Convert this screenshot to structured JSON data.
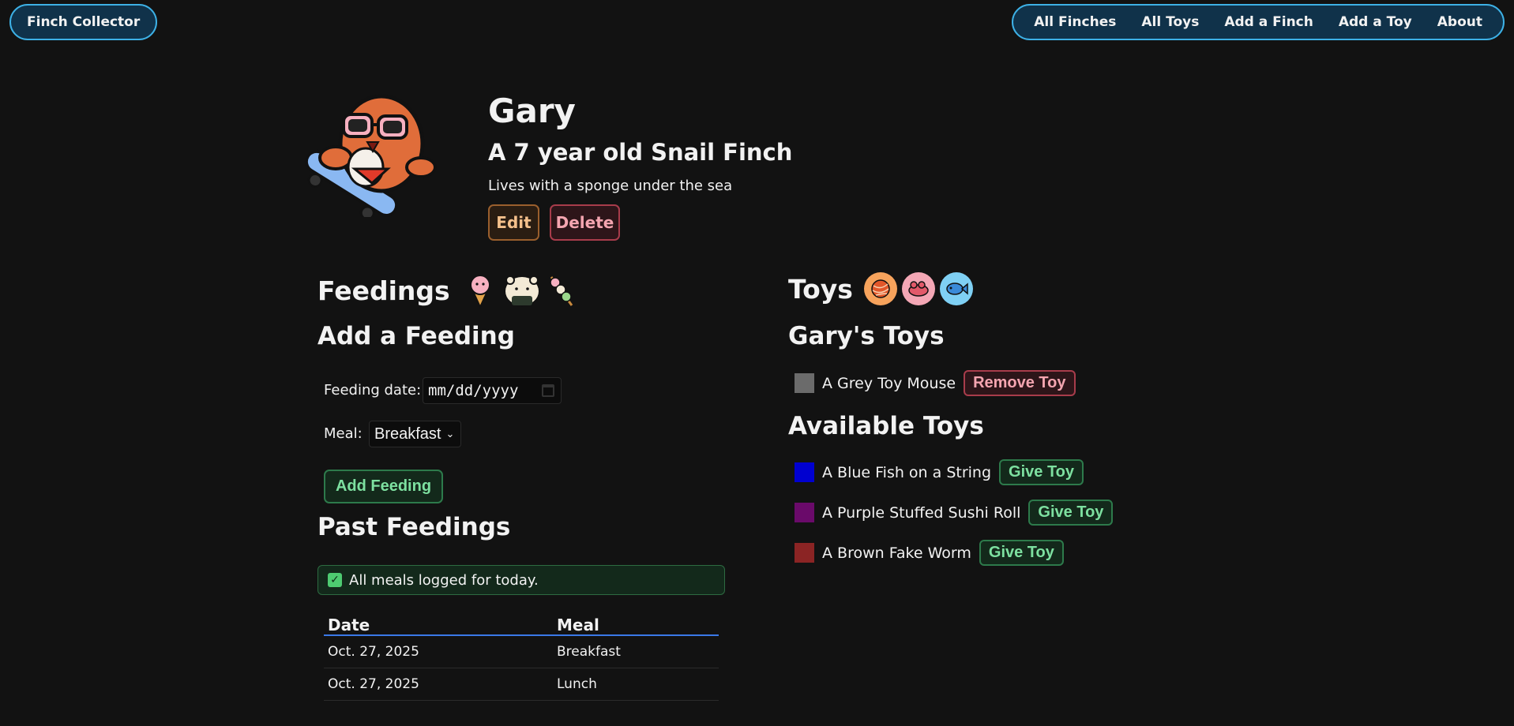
{
  "nav": {
    "brand": "Finch Collector",
    "links": [
      "All Finches",
      "All Toys",
      "Add a Finch",
      "Add a Toy",
      "About"
    ]
  },
  "finch": {
    "name": "Gary",
    "subtitle": "A 7 year old Snail Finch",
    "description": "Lives with a sponge under the sea",
    "avatar_icon": "finch-skateboard-icon",
    "edit_label": "Edit",
    "delete_label": "Delete"
  },
  "feedings": {
    "heading": "Feedings",
    "emojis": [
      "ice-cream-icon",
      "rice-ball-icon",
      "dango-icon"
    ],
    "add_heading": "Add a Feeding",
    "date_label": "Feeding date:",
    "date_placeholder": "mm/dd/yyyy",
    "meal_label": "Meal:",
    "meal_selected": "Breakfast",
    "add_button": "Add Feeding",
    "past_heading": "Past Feedings",
    "alert": "All meals logged for today.",
    "table": {
      "headers": [
        "Date",
        "Meal"
      ],
      "rows": [
        [
          "Oct. 27, 2025",
          "Breakfast"
        ],
        [
          "Oct. 27, 2025",
          "Lunch"
        ]
      ]
    }
  },
  "toys": {
    "heading": "Toys",
    "icons": [
      {
        "name": "yarn-ball-icon",
        "bg": "#f7a35c"
      },
      {
        "name": "toy-mouse-icon",
        "bg": "#f4a7b5"
      },
      {
        "name": "fish-toy-icon",
        "bg": "#7fd0f4"
      }
    ],
    "owned_heading": "Gary's Toys",
    "owned": [
      {
        "name": "A Grey Toy Mouse",
        "color": "#6b6b6b",
        "button": "Remove Toy"
      }
    ],
    "available_heading": "Available Toys",
    "available": [
      {
        "name": "A Blue Fish on a String",
        "color": "#0000d0",
        "button": "Give Toy"
      },
      {
        "name": "A Purple Stuffed Sushi Roll",
        "color": "#6a0a6a",
        "button": "Give Toy"
      },
      {
        "name": "A Brown Fake Worm",
        "color": "#8b2424",
        "button": "Give Toy"
      }
    ]
  }
}
